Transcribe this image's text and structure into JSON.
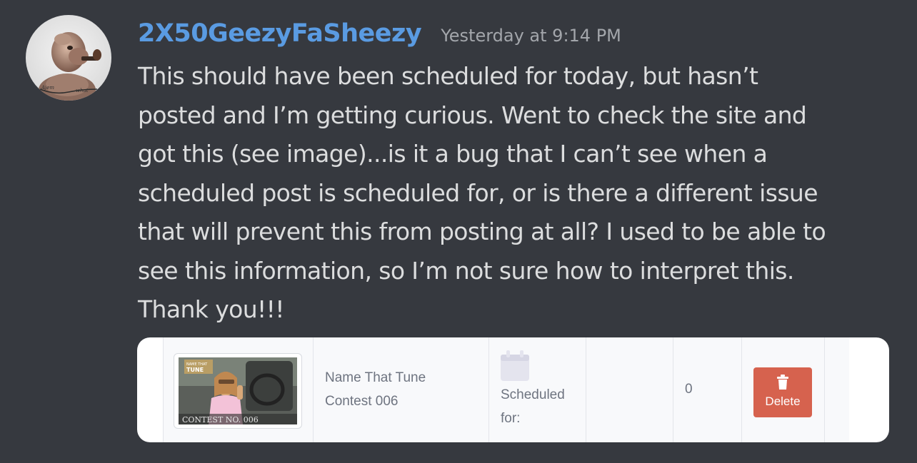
{
  "message": {
    "username": "2X50GeezyFaSheezy",
    "timestamp": "Yesterday at 9:14 PM",
    "text": "This should have been scheduled for today, but hasn’t\nposted and I’m getting curious.  Went to check the site and\ngot this (see image)...is it a bug that I can’t see when a\nscheduled post is scheduled for, or is there a different issue\nthat will prevent this from posting at all?  I used to be able to\nsee this information, so I’m not sure how to interpret this.\nThank you!!!"
  },
  "avatar": {
    "icon": "popeye-avatar-icon"
  },
  "attachment": {
    "thumbnail_caption": "CONTEST NO. 006",
    "title_line1": "Name That Tune",
    "title_line2": "Contest 006",
    "schedule_icon": "calendar-icon",
    "scheduled_label_line1": "Scheduled",
    "scheduled_label_line2": "for:",
    "count": "0",
    "delete_label": "Delete",
    "delete_icon": "trash-icon",
    "colors": {
      "delete_bg": "#d6624e",
      "username": "#5a9be2"
    }
  }
}
